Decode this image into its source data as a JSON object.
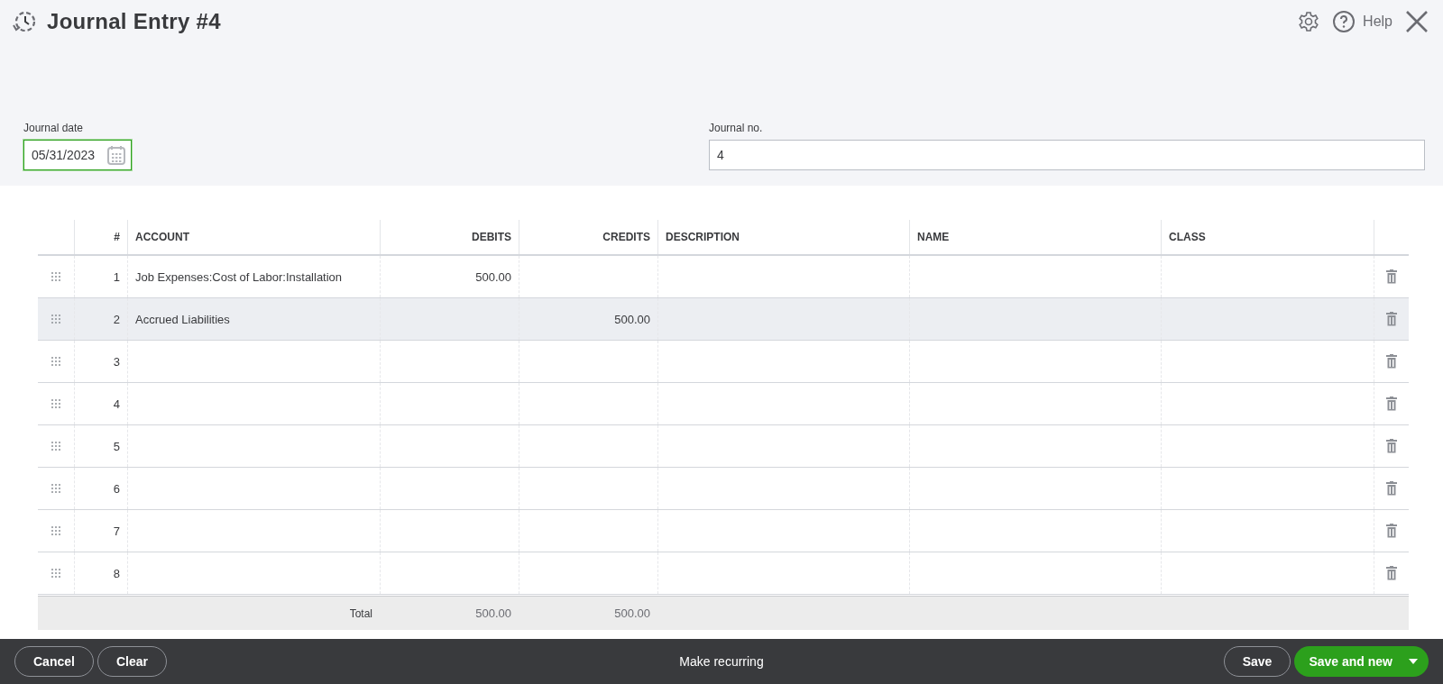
{
  "header": {
    "title": "Journal Entry #4",
    "help_label": "Help"
  },
  "fields": [
    {
      "kind": "date",
      "label": "Journal date",
      "value": "05/31/2023",
      "focused": true
    },
    {
      "kind": "text",
      "label": "Journal no.",
      "value": "4",
      "focused": false
    }
  ],
  "table": {
    "columns": [
      "#",
      "ACCOUNT",
      "DEBITS",
      "CREDITS",
      "DESCRIPTION",
      "NAME",
      "CLASS"
    ],
    "rows": [
      {
        "number": "1",
        "account": "Job Expenses:Cost of Labor:Installation",
        "debits": "500.00",
        "credits": "",
        "selected": false
      },
      {
        "number": "2",
        "account": "Accrued Liabilities",
        "debits": "",
        "credits": "500.00",
        "selected": true
      },
      {
        "number": "3",
        "account": "",
        "debits": "",
        "credits": "",
        "selected": false
      },
      {
        "number": "4",
        "account": "",
        "debits": "",
        "credits": "",
        "selected": false
      },
      {
        "number": "5",
        "account": "",
        "debits": "",
        "credits": "",
        "selected": false
      },
      {
        "number": "6",
        "account": "",
        "debits": "",
        "credits": "",
        "selected": false
      },
      {
        "number": "7",
        "account": "",
        "debits": "",
        "credits": "",
        "selected": false
      },
      {
        "number": "8",
        "account": "",
        "debits": "",
        "credits": "",
        "selected": false
      }
    ],
    "total": {
      "label": "Total",
      "debits": "500.00",
      "credits": "500.00"
    }
  },
  "footer": {
    "left_buttons": [
      "Cancel",
      "Clear"
    ],
    "center_link": "Make recurring",
    "save": "Save",
    "save_and_new": "Save and new"
  }
}
